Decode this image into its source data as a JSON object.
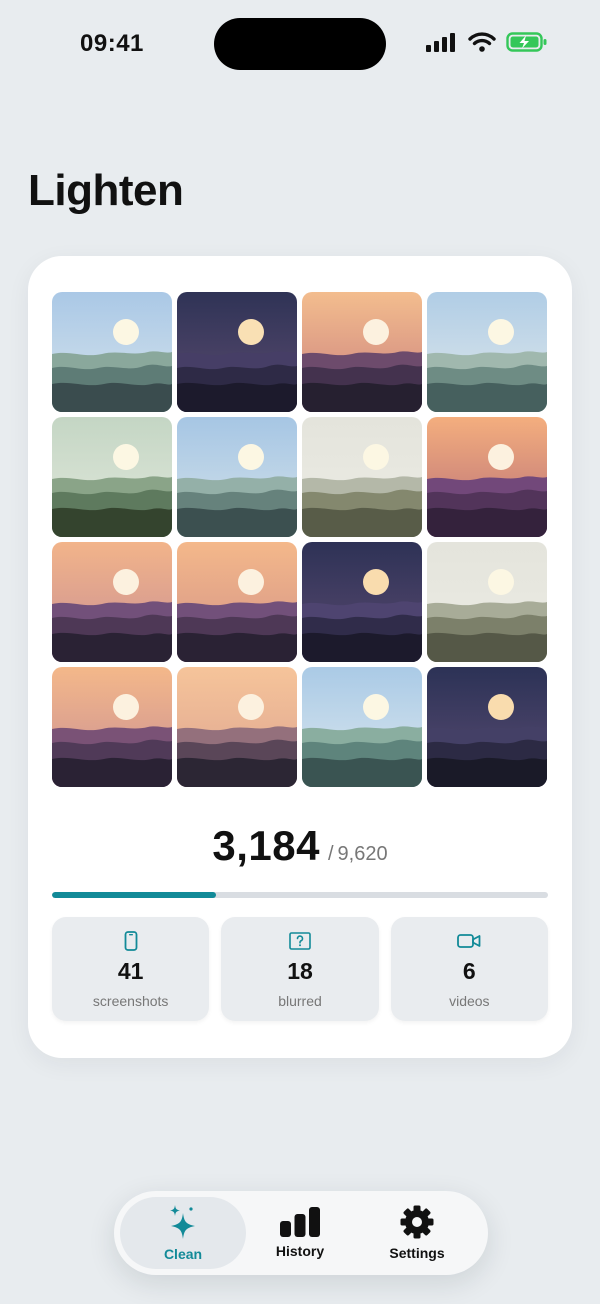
{
  "status_bar": {
    "time": "09:41"
  },
  "app": {
    "title": "Lighten"
  },
  "colors": {
    "accent": "#128a98",
    "battery": "#34c759",
    "background": "#e8ecef"
  },
  "photos": [
    {
      "sky": [
        "#aac8e6",
        "#d6e4ec"
      ],
      "sun": "#fcf7e3",
      "m": [
        "#8aa89c",
        "#5e7c76",
        "#3a4c4e"
      ]
    },
    {
      "sky": [
        "#2f3356",
        "#5c4c70"
      ],
      "sun": "#f9e0b4",
      "m": [
        "#463e66",
        "#2e2a46",
        "#1c1a2c"
      ]
    },
    {
      "sky": [
        "#f3bd8e",
        "#c97e7e"
      ],
      "sun": "#fcf1df",
      "m": [
        "#6d4b6c",
        "#44324e",
        "#262030"
      ]
    },
    {
      "sky": [
        "#b0cde6",
        "#e0e8ea"
      ],
      "sun": "#fcf7e3",
      "m": [
        "#a0b8ae",
        "#6e8c84",
        "#46605e"
      ]
    },
    {
      "sky": [
        "#c4d6c4",
        "#e2e8dc"
      ],
      "sun": "#fcf7e3",
      "m": [
        "#8aa488",
        "#5e7a5e",
        "#34442e"
      ]
    },
    {
      "sky": [
        "#a6c6e4",
        "#d4e2ea"
      ],
      "sun": "#fcf7e3",
      "m": [
        "#94b0a8",
        "#66827c",
        "#3c5050"
      ]
    },
    {
      "sky": [
        "#e4e4dc",
        "#ecece4"
      ],
      "sun": "#fcf7e3",
      "m": [
        "#b4b8a8",
        "#84886e",
        "#585c48"
      ]
    },
    {
      "sky": [
        "#f4ae7e",
        "#b66e78"
      ],
      "sun": "#fcf1df",
      "m": [
        "#72487a",
        "#52345a",
        "#34223c"
      ]
    },
    {
      "sky": [
        "#f2b48a",
        "#c88e94"
      ],
      "sun": "#fcf1df",
      "m": [
        "#72507a",
        "#4e3856",
        "#2a2234"
      ]
    },
    {
      "sky": [
        "#f4b88a",
        "#d29288"
      ],
      "sun": "#fcf1df",
      "m": [
        "#72507a",
        "#4e3856",
        "#2a2234"
      ]
    },
    {
      "sky": [
        "#2e3256",
        "#5a4a70"
      ],
      "sun": "#f9dcae",
      "m": [
        "#4e4470",
        "#302c4a",
        "#1c1a2c"
      ]
    },
    {
      "sky": [
        "#e4e4dc",
        "#ecece4"
      ],
      "sun": "#fcf7e3",
      "m": [
        "#a8ac98",
        "#7c806a",
        "#555847"
      ]
    },
    {
      "sky": [
        "#f4b88a",
        "#c88e94"
      ],
      "sun": "#fcf1df",
      "m": [
        "#7a5276",
        "#503a58",
        "#2a2234"
      ]
    },
    {
      "sky": [
        "#f6c49a",
        "#dca490"
      ],
      "sun": "#fcf1df",
      "m": [
        "#94707c",
        "#5a4658",
        "#2c2634"
      ]
    },
    {
      "sky": [
        "#aacae6",
        "#dce8ee"
      ],
      "sun": "#fcf7e3",
      "m": [
        "#8aaea0",
        "#5e847c",
        "#3a5452"
      ]
    },
    {
      "sky": [
        "#2c3256",
        "#5a4c72"
      ],
      "sun": "#f9dcae",
      "m": [
        "#444066",
        "#2c2a44",
        "#1a1a28"
      ]
    }
  ],
  "progress": {
    "current": "3,184",
    "separator": "/",
    "total": "9,620",
    "fraction": 0.331
  },
  "stats": [
    {
      "icon": "phone-icon",
      "value": "41",
      "label": "screenshots"
    },
    {
      "icon": "blurred-question-icon",
      "value": "18",
      "label": "blurred"
    },
    {
      "icon": "video-camera-icon",
      "value": "6",
      "label": "videos"
    }
  ],
  "tabbar": {
    "tabs": [
      {
        "icon": "sparkles-icon",
        "label": "Clean",
        "active": true
      },
      {
        "icon": "bar-chart-icon",
        "label": "History",
        "active": false
      },
      {
        "icon": "gear-icon",
        "label": "Settings",
        "active": false
      }
    ]
  }
}
